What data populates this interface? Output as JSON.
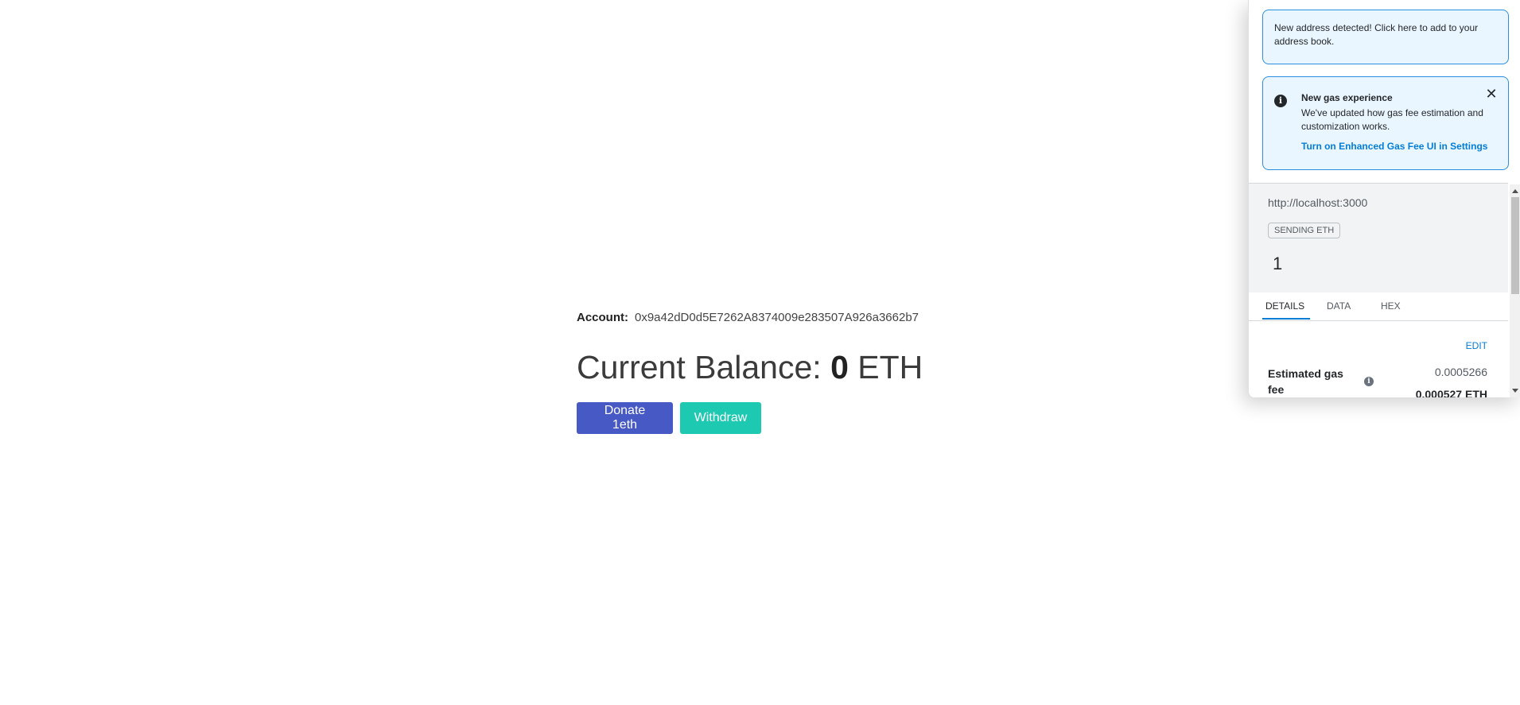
{
  "dapp": {
    "account_label": "Account:",
    "account_address": "0x9a42dD0d5E7262A8374009e283507A926a3662b7",
    "balance_prefix": "Current Balance: ",
    "balance_value": "0",
    "balance_unit": " ETH",
    "donate_label": "Donate 1eth",
    "withdraw_label": "Withdraw",
    "colors": {
      "donate": "#4759c4",
      "withdraw": "#1ec9b1"
    }
  },
  "metamask": {
    "address_notice": "New address detected! Click here to add to your address book.",
    "gas_notice": {
      "title": "New gas experience",
      "description": "We've updated how gas fee estimation and customization works.",
      "link": "Turn on Enhanced Gas Fee UI in Settings",
      "info_icon": "i",
      "close_icon": "✕"
    },
    "origin": "http://localhost:3000",
    "badge": "SENDING ETH",
    "amount": "1",
    "tabs": [
      "DETAILS",
      "DATA",
      "HEX"
    ],
    "details": {
      "edit_label": "EDIT",
      "gas_fee_label": "Estimated gas fee",
      "fee_secondary": "0.0005266",
      "fee_primary": "0.000527 ETH",
      "info_icon": "i"
    },
    "colors": {
      "link": "#037dd6",
      "notice_bg": "#eaf6ff",
      "notice_border": "#2d8ee0"
    }
  }
}
